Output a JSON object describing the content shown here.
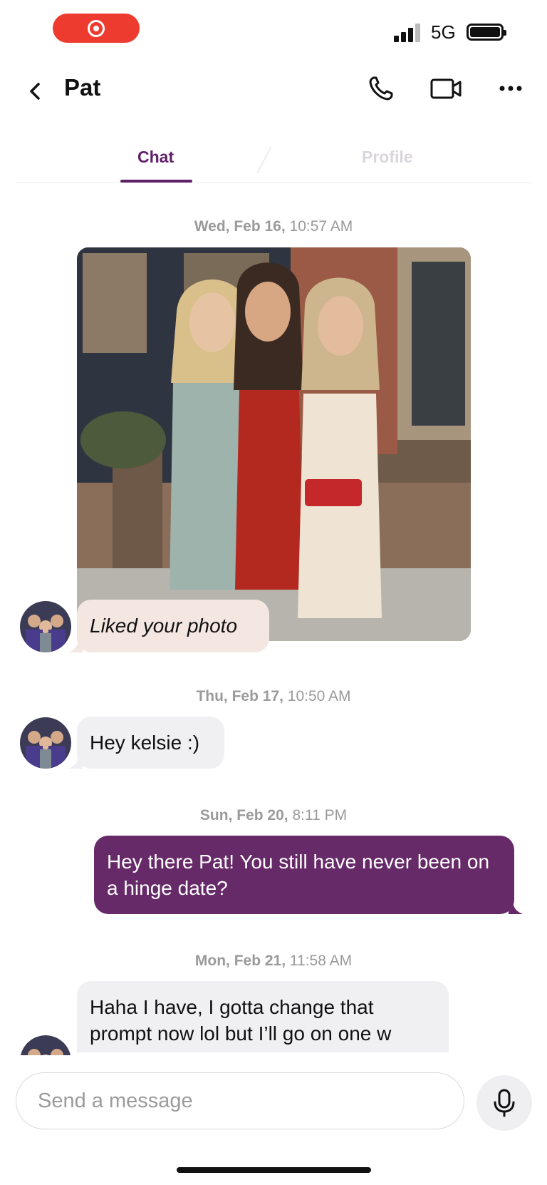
{
  "status_bar": {
    "network": "5G"
  },
  "header": {
    "back_label": "back",
    "contact_name": "Pat"
  },
  "tabs": {
    "chat": "Chat",
    "profile": "Profile"
  },
  "messages": [
    {
      "timestamp_day": "Wed, Feb 16,",
      "timestamp_time": " 10:57 AM",
      "type": "photo-like",
      "text": "Liked your photo"
    },
    {
      "timestamp_day": "Thu, Feb 17,",
      "timestamp_time": " 10:50 AM",
      "type": "incoming",
      "text": "Hey kelsie :)"
    },
    {
      "timestamp_day": "Sun, Feb 20,",
      "timestamp_time": " 8:11 PM",
      "type": "outgoing",
      "text": "Hey there Pat! You still have never been on a hinge date?"
    },
    {
      "timestamp_day": "Mon, Feb 21,",
      "timestamp_time": " 11:58 AM",
      "type": "incoming",
      "text": "Haha I have, I gotta change that prompt now lol but I’ll go on one w"
    }
  ],
  "composer": {
    "placeholder": "Send a message"
  },
  "colors": {
    "brand": "#662a68",
    "tab_active": "#5f2068",
    "liked_bubble": "#f4e6e1",
    "incoming_bubble": "#f0eff2",
    "record": "#ee3b2f"
  },
  "icons": [
    "record-icon",
    "signal-icon",
    "battery-icon",
    "chevron-left-icon",
    "phone-icon",
    "video-icon",
    "more-icon",
    "microphone-icon"
  ]
}
